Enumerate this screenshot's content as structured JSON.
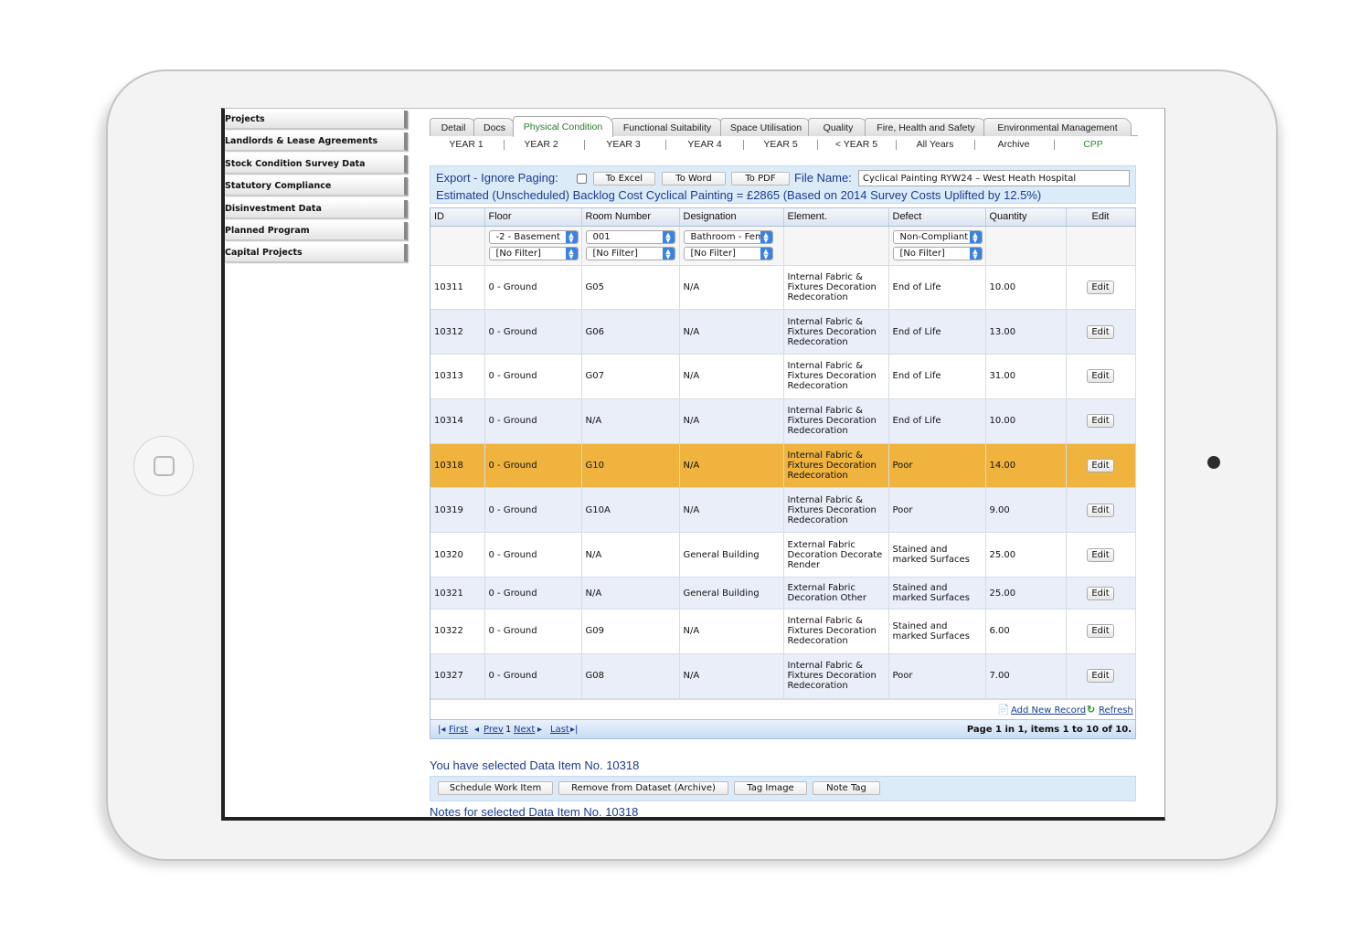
{
  "sidebar": {
    "items": [
      {
        "label": "Projects"
      },
      {
        "label": "Landlords & Lease Agreements"
      },
      {
        "label": "Stock Condition Survey Data"
      },
      {
        "label": "Statutory Compliance"
      },
      {
        "label": "Disinvestment Data"
      },
      {
        "label": "Planned Program"
      },
      {
        "label": "Capital Projects"
      }
    ]
  },
  "tabs": [
    {
      "label": "Detail"
    },
    {
      "label": "Docs"
    },
    {
      "label": "Physical Condition",
      "active": true
    },
    {
      "label": "Functional Suitability"
    },
    {
      "label": "Space Utilisation"
    },
    {
      "label": "Quality"
    },
    {
      "label": "Fire, Health and Safety"
    },
    {
      "label": "Environmental Management"
    }
  ],
  "years": [
    {
      "label": "YEAR 1"
    },
    {
      "label": "YEAR 2"
    },
    {
      "label": "YEAR 3"
    },
    {
      "label": "YEAR 4"
    },
    {
      "label": "YEAR 5"
    },
    {
      "label": "< YEAR 5"
    },
    {
      "label": "All Years"
    },
    {
      "label": "Archive"
    },
    {
      "label": "CPP"
    }
  ],
  "export": {
    "label": "Export - Ignore Paging:",
    "to_excel": "To Excel",
    "to_word": "To Word",
    "to_pdf": "To PDF",
    "file_name_label": "File Name:",
    "file_name_value": "Cyclical Painting RYW24 – West Heath Hospital"
  },
  "estimate_text": "Estimated (Unscheduled) Backlog Cost Cyclical Painting = £2865 (Based on 2014 Survey Costs Uplifted by 12.5%)",
  "grid": {
    "columns": [
      "ID",
      "Floor",
      "Room Number",
      "Designation",
      "Element.",
      "Defect",
      "Quantity",
      "Edit"
    ],
    "filters": {
      "floor": "-2 - Basement",
      "floor_default": "[No Filter]",
      "room": "001",
      "room_default": "[No Filter]",
      "designation": "Bathroom - Fem",
      "designation_default": "[No Filter]",
      "defect": "Non-Compliant",
      "defect_default": "[No Filter]"
    },
    "rows": [
      {
        "id": "10311",
        "floor": "0 - Ground",
        "room": "G05",
        "designation": "N/A",
        "element": "Internal Fabric & Fixtures Decoration Redecoration",
        "defect": "End of Life",
        "quantity": "10.00",
        "edit": "Edit"
      },
      {
        "id": "10312",
        "floor": "0 - Ground",
        "room": "G06",
        "designation": "N/A",
        "element": "Internal Fabric & Fixtures Decoration Redecoration",
        "defect": "End of Life",
        "quantity": "13.00",
        "edit": "Edit"
      },
      {
        "id": "10313",
        "floor": "0 - Ground",
        "room": "G07",
        "designation": "N/A",
        "element": "Internal Fabric & Fixtures Decoration Redecoration",
        "defect": "End of Life",
        "quantity": "31.00",
        "edit": "Edit"
      },
      {
        "id": "10314",
        "floor": "0 - Ground",
        "room": "N/A",
        "designation": "N/A",
        "element": "Internal Fabric & Fixtures Decoration Redecoration",
        "defect": "End of Life",
        "quantity": "10.00",
        "edit": "Edit"
      },
      {
        "id": "10318",
        "floor": "0 - Ground",
        "room": "G10",
        "designation": "N/A",
        "element": "Internal Fabric & Fixtures Decoration Redecoration",
        "defect": "Poor",
        "quantity": "14.00",
        "edit": "Edit"
      },
      {
        "id": "10319",
        "floor": "0 - Ground",
        "room": "G10A",
        "designation": "N/A",
        "element": "Internal Fabric & Fixtures Decoration Redecoration",
        "defect": "Poor",
        "quantity": "9.00",
        "edit": "Edit"
      },
      {
        "id": "10320",
        "floor": "0 - Ground",
        "room": "N/A",
        "designation": "General Building",
        "element": "External Fabric Decoration Decorate Render",
        "defect": "Stained and marked Surfaces",
        "quantity": "25.00",
        "edit": "Edit"
      },
      {
        "id": "10321",
        "floor": "0 - Ground",
        "room": "N/A",
        "designation": "General Building",
        "element": "External Fabric Decoration Other",
        "defect": "Stained and marked Surfaces",
        "quantity": "25.00",
        "edit": "Edit"
      },
      {
        "id": "10322",
        "floor": "0 - Ground",
        "room": "G09",
        "designation": "N/A",
        "element": "Internal Fabric & Fixtures Decoration Redecoration",
        "defect": "Stained and marked Surfaces",
        "quantity": "6.00",
        "edit": "Edit"
      },
      {
        "id": "10327",
        "floor": "0 - Ground",
        "room": "G08",
        "designation": "N/A",
        "element": "Internal Fabric & Fixtures Decoration Redecoration",
        "defect": "Poor",
        "quantity": "7.00",
        "edit": "Edit"
      }
    ],
    "selected_row_id": "10318",
    "add_new_record": "Add New Record",
    "refresh": "Refresh",
    "pager": {
      "first": "First",
      "prev": "Prev",
      "page_number": "1",
      "next": "Next",
      "last": "Last",
      "summary": "Page 1 in 1, items 1 to 10 of 10."
    }
  },
  "selected_text": "You have selected Data Item No. 10318",
  "actions": {
    "schedule": "Schedule Work Item",
    "remove": "Remove from Dataset (Archive)",
    "tag_image": "Tag Image",
    "note_tag": "Note Tag"
  },
  "notes_text": "Notes for selected Data Item No. 10318",
  "colors": {
    "selected_row": "#efb33e",
    "alt_row": "#e9eef8",
    "accent_text": "#1a3c8f",
    "active_tab_text": "#2a7a2a"
  }
}
